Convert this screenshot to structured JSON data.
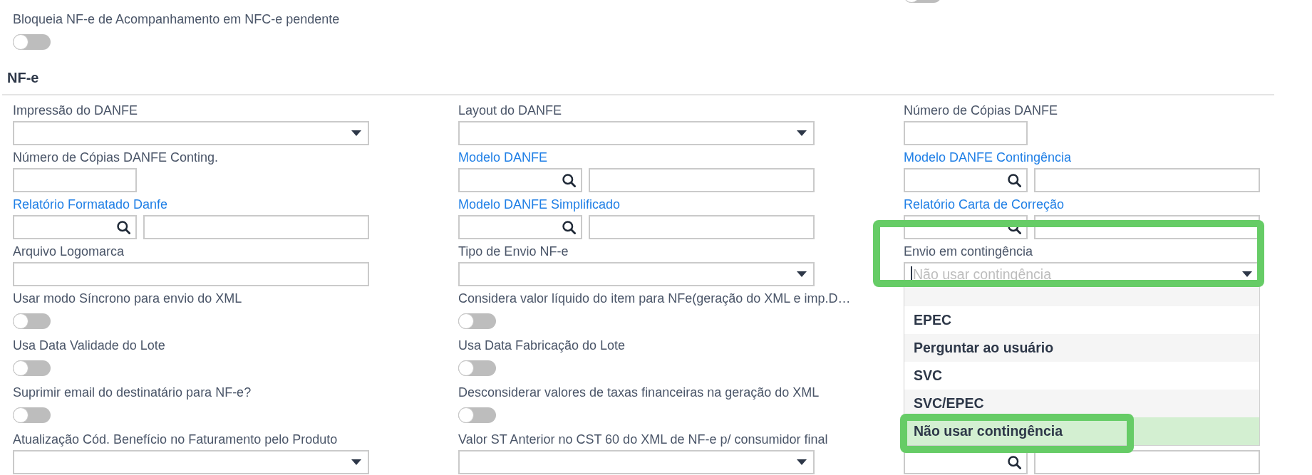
{
  "top_rows": [
    [
      null,
      null,
      {
        "kind": "toggle",
        "on": false
      }
    ],
    [
      {
        "kind": "toggle",
        "label": "Bloqueia NF-e de Acompanhamento em NFC-e pendente",
        "on": false
      },
      null,
      null
    ]
  ],
  "section": {
    "title": "NF-e",
    "rows": [
      [
        {
          "kind": "select",
          "label": "Impressão do DANFE",
          "expanded": false,
          "highlighted": false
        },
        {
          "kind": "select",
          "label": "Layout do DANFE",
          "expanded": false,
          "highlighted": false
        },
        {
          "kind": "number",
          "label": "Número de Cópias DANFE",
          "highlighted": false
        }
      ],
      [
        {
          "kind": "number",
          "label": "Número de Cópias DANFE Conting.",
          "highlighted": false
        },
        {
          "kind": "lookup",
          "label": "Modelo DANFE",
          "highlighted": false
        },
        {
          "kind": "lookup",
          "label": "Modelo DANFE Contingência",
          "highlighted": false
        }
      ],
      [
        {
          "kind": "lookup",
          "label": "Relatório Formatado Danfe",
          "highlighted": false
        },
        {
          "kind": "lookup",
          "label": "Modelo DANFE Simplificado",
          "highlighted": false
        },
        {
          "kind": "lookup",
          "label": "Relatório Carta de Correção",
          "highlighted": false
        }
      ],
      [
        {
          "kind": "text",
          "label": "Arquivo Logomarca",
          "highlighted": false
        },
        {
          "kind": "select",
          "label": "Tipo de Envio NF-e",
          "expanded": false,
          "highlighted": false
        },
        {
          "kind": "select",
          "label": "Envio em contingência",
          "placeholder": "Não usar contingência",
          "expanded": true,
          "highlighted": true,
          "options": [
            {
              "kind": "blank",
              "selected": false,
              "highlighted": false
            },
            {
              "kind": "text",
              "label": "EPEC",
              "selected": false,
              "highlighted": false
            },
            {
              "kind": "text",
              "label": "Perguntar ao usuário",
              "selected": false,
              "highlighted": false
            },
            {
              "kind": "text",
              "label": "SVC",
              "selected": false,
              "highlighted": false
            },
            {
              "kind": "text",
              "label": "SVC/EPEC",
              "selected": false,
              "highlighted": false
            },
            {
              "kind": "text",
              "label": "Não usar contingência",
              "selected": true,
              "highlighted": true
            }
          ]
        }
      ],
      [
        {
          "kind": "toggle",
          "label": "Usar modo Síncrono para envio do XML",
          "on": false,
          "highlighted": false
        },
        {
          "kind": "toggle",
          "label": "Considera valor líquido do item para NFe(geração do XML e imp.D…",
          "on": false,
          "highlighted": false
        },
        null
      ],
      [
        {
          "kind": "toggle",
          "label": "Usa Data Validade do Lote",
          "on": false,
          "highlighted": false
        },
        {
          "kind": "toggle",
          "label": "Usa Data Fabricação do Lote",
          "on": false,
          "highlighted": false
        },
        null
      ],
      [
        {
          "kind": "toggle",
          "label": "Suprimir email do destinatário para NF-e?",
          "on": false,
          "highlighted": false
        },
        {
          "kind": "toggle",
          "label": "Desconsiderar valores de taxas financeiras na geração do XML",
          "on": false,
          "highlighted": false
        },
        null
      ],
      [
        {
          "kind": "select",
          "label": "Atualização Cód. Benefício no Faturamento pelo Produto",
          "expanded": false,
          "highlighted": false
        },
        {
          "kind": "select",
          "label": "Valor ST Anterior no CST 60 do XML de NF-e p/ consumidor final",
          "expanded": false,
          "highlighted": false
        },
        {
          "kind": "lookup",
          "highlighted": false
        }
      ]
    ]
  }
}
